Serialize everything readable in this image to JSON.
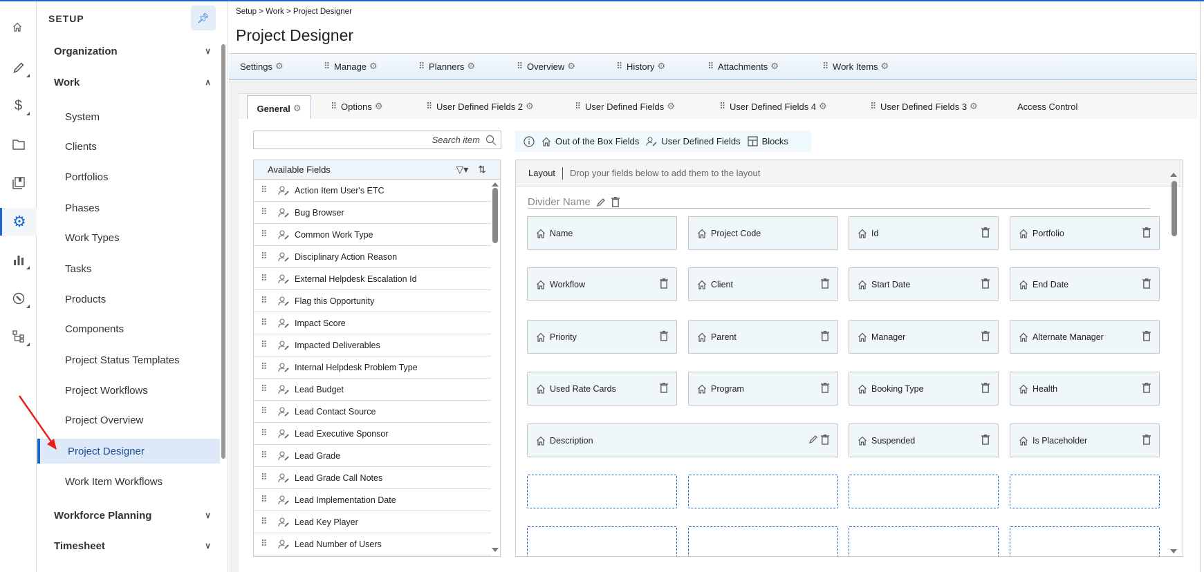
{
  "colors": {
    "accent": "#1a66c9",
    "arrow": "#e8201a",
    "tab_bg": "#e4f0f9",
    "card_bg": "#f0f7fb"
  },
  "iconbar": [
    {
      "icon": "home-icon"
    },
    {
      "icon": "pencil-icon"
    },
    {
      "icon": "dollar-icon"
    },
    {
      "icon": "folder-icon"
    },
    {
      "icon": "book-icon"
    },
    {
      "icon": "gear-icon",
      "selected": true
    },
    {
      "icon": "bar-chart-icon"
    },
    {
      "icon": "wrench-icon"
    },
    {
      "icon": "hierarchy-icon"
    }
  ],
  "sidebar": {
    "title": "SETUP",
    "pin_icon": "pin-icon",
    "items": [
      {
        "label": "Organization",
        "type": "group",
        "expanded": false
      },
      {
        "label": "Work",
        "type": "group",
        "expanded": true
      },
      {
        "label": "System",
        "type": "sub"
      },
      {
        "label": "Clients",
        "type": "sub"
      },
      {
        "label": "Portfolios",
        "type": "sub"
      },
      {
        "label": "Phases",
        "type": "sub"
      },
      {
        "label": "Work Types",
        "type": "sub"
      },
      {
        "label": "Tasks",
        "type": "sub"
      },
      {
        "label": "Products",
        "type": "sub"
      },
      {
        "label": "Components",
        "type": "sub"
      },
      {
        "label": "Project Status Templates",
        "type": "sub"
      },
      {
        "label": "Project Workflows",
        "type": "sub"
      },
      {
        "label": "Project Overview",
        "type": "sub"
      },
      {
        "label": "Project Designer",
        "type": "sub",
        "selected": true
      },
      {
        "label": "Work Item Workflows",
        "type": "sub"
      },
      {
        "label": "Workforce Planning",
        "type": "group",
        "expanded": false
      },
      {
        "label": "Timesheet",
        "type": "group",
        "expanded": false
      }
    ]
  },
  "header": {
    "breadcrumb": "Setup > Work > Project Designer",
    "title": "Project Designer"
  },
  "tabs": [
    {
      "label": "Settings",
      "drag": false
    },
    {
      "label": "Manage",
      "drag": true
    },
    {
      "label": "Planners",
      "drag": true
    },
    {
      "label": "Overview",
      "drag": true
    },
    {
      "label": "History",
      "drag": true
    },
    {
      "label": "Attachments",
      "drag": true
    },
    {
      "label": "Work Items",
      "drag": true
    }
  ],
  "subtabs": [
    {
      "label": "General",
      "selected": true,
      "drag": false,
      "gear": true
    },
    {
      "label": "Options",
      "drag": true,
      "gear": true
    },
    {
      "label": "User Defined Fields 2",
      "drag": true,
      "gear": true
    },
    {
      "label": "User Defined Fields",
      "drag": true,
      "gear": true
    },
    {
      "label": "User Defined Fields 4",
      "drag": true,
      "gear": true
    },
    {
      "label": "User Defined Fields 3",
      "drag": true,
      "gear": true
    },
    {
      "label": "Access Control",
      "drag": false,
      "gear": false
    }
  ],
  "search": {
    "placeholder": "Search item",
    "value": ""
  },
  "available_fields": {
    "title": "Available Fields",
    "items": [
      "Action Item User's ETC",
      "Bug Browser",
      "Common Work Type",
      "Disciplinary Action Reason",
      "External Helpdesk Escalation Id",
      "Flag this Opportunity",
      "Impact Score",
      "Impacted Deliverables",
      "Internal Helpdesk Problem Type",
      "Lead Budget",
      "Lead Contact Source",
      "Lead Executive Sponsor",
      "Lead Grade",
      "Lead Grade Call Notes",
      "Lead Implementation Date",
      "Lead Key Player",
      "Lead Number of Users"
    ]
  },
  "legend": {
    "ootb": "Out of the Box Fields",
    "udf": "User Defined Fields",
    "blocks": "Blocks"
  },
  "layout": {
    "label": "Layout",
    "hint": "Drop your fields below to add them to the layout",
    "divider_name": "Divider Name",
    "rows": [
      [
        {
          "label": "Name",
          "delete": false
        },
        {
          "label": "Project Code",
          "delete": false
        },
        {
          "label": "Id",
          "delete": true
        },
        {
          "label": "Portfolio",
          "delete": true
        }
      ],
      [
        {
          "label": "Workflow",
          "delete": true
        },
        {
          "label": "Client",
          "delete": true
        },
        {
          "label": "Start Date",
          "delete": true
        },
        {
          "label": "End Date",
          "delete": true
        }
      ],
      [
        {
          "label": "Priority",
          "delete": true
        },
        {
          "label": "Parent",
          "delete": true
        },
        {
          "label": "Manager",
          "delete": true
        },
        {
          "label": "Alternate Manager",
          "delete": true
        }
      ],
      [
        {
          "label": "Used Rate Cards",
          "delete": true
        },
        {
          "label": "Program",
          "delete": true
        },
        {
          "label": "Booking Type",
          "delete": true
        },
        {
          "label": "Health",
          "delete": true
        }
      ],
      [
        {
          "label": "Description",
          "delete": true,
          "edit": true,
          "span": 2
        },
        {
          "label": "Suspended",
          "delete": true
        },
        {
          "label": "Is Placeholder",
          "delete": true
        }
      ]
    ],
    "empty_rows": 2
  }
}
